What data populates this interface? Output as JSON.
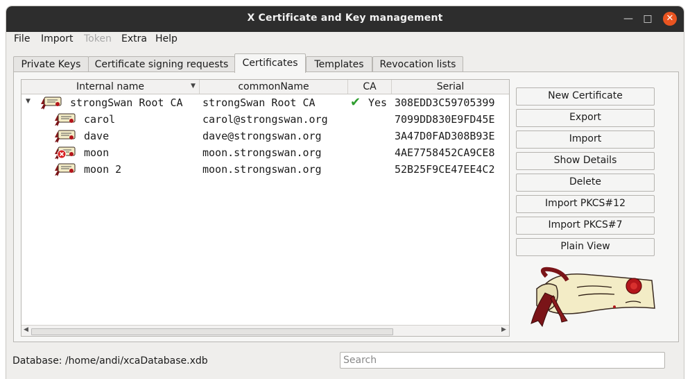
{
  "window": {
    "title": "X Certificate and Key management"
  },
  "menubar": {
    "file": "File",
    "import": "Import",
    "token": "Token",
    "extra": "Extra",
    "help": "Help"
  },
  "tabs": [
    {
      "label": "Private Keys"
    },
    {
      "label": "Certificate signing requests"
    },
    {
      "label": "Certificates",
      "active": true
    },
    {
      "label": "Templates"
    },
    {
      "label": "Revocation lists"
    }
  ],
  "table": {
    "columns": [
      "Internal name",
      "commonName",
      "CA",
      "Serial"
    ],
    "rows": [
      {
        "name": "strongSwan Root CA",
        "cn": "strongSwan Root CA",
        "ca": "Yes",
        "serial": "308EDD3C59705399",
        "level": 0,
        "icon": "cert-icon"
      },
      {
        "name": "carol",
        "cn": "carol@strongswan.org",
        "ca": "",
        "serial": "7099DD830E9FD45E",
        "level": 1,
        "icon": "cert-icon"
      },
      {
        "name": "dave",
        "cn": "dave@strongswan.org",
        "ca": "",
        "serial": "3A47D0FAD308B93E",
        "level": 1,
        "icon": "cert-icon"
      },
      {
        "name": "moon",
        "cn": "moon.strongswan.org",
        "ca": "",
        "serial": "4AE7758452CA9CE8",
        "level": 1,
        "icon": "revoked-cert-icon"
      },
      {
        "name": "moon 2",
        "cn": "moon.strongswan.org",
        "ca": "",
        "serial": "52B25F9CE47EE4C2",
        "level": 1,
        "icon": "cert-icon"
      }
    ]
  },
  "buttons": {
    "new_certificate": "New Certificate",
    "export": "Export",
    "import": "Import",
    "show_details": "Show Details",
    "delete": "Delete",
    "import_pkcs12": "Import PKCS#12",
    "import_pkcs7": "Import PKCS#7",
    "plain_view": "Plain View"
  },
  "status": {
    "database": "Database: /home/andi/xcaDatabase.xdb"
  },
  "search": {
    "placeholder": "Search"
  },
  "colors": {
    "accent_close": "#e95420",
    "titlebar": "#2d2d2d",
    "check": "#2e9d2e"
  }
}
